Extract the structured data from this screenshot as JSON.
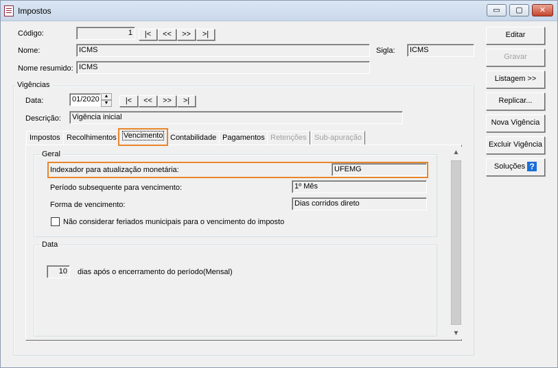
{
  "window": {
    "title": "Impostos",
    "controls": {
      "minimize": "▭",
      "maximize": "▢",
      "close": "✕"
    }
  },
  "header": {
    "codigo_label": "Código:",
    "codigo_value": "1",
    "nome_label": "Nome:",
    "nome_value": "ICMS",
    "sigla_label": "Sigla:",
    "sigla_value": "ICMS",
    "nome_resumido_label": "Nome resumido:",
    "nome_resumido_value": "ICMS"
  },
  "nav": {
    "first": "|<",
    "prev": "<<",
    "next": ">>",
    "last": ">|"
  },
  "vigencias": {
    "legend": "Vigências",
    "data_label": "Data:",
    "data_value": "01/2020",
    "descricao_label": "Descrição:",
    "descricao_value": "Vigência inicial"
  },
  "tabs": [
    {
      "label": "Impostos",
      "state": "normal"
    },
    {
      "label": "Recolhimentos",
      "state": "normal"
    },
    {
      "label": "Vencimento",
      "state": "active"
    },
    {
      "label": "Contabilidade",
      "state": "normal"
    },
    {
      "label": "Pagamentos",
      "state": "normal"
    },
    {
      "label": "Retenções",
      "state": "disabled"
    },
    {
      "label": "Sub-apuração",
      "state": "disabled"
    }
  ],
  "geral": {
    "legend": "Geral",
    "indexador_label": "Indexador para atualização monetária:",
    "indexador_value": "UFEMG",
    "periodo_label": "Período subsequente para vencimento:",
    "periodo_value": "1º Mês",
    "forma_label": "Forma de vencimento:",
    "forma_value": "Dias corridos direto",
    "feriados_label": "Não considerar feriados municipais para o vencimento do imposto",
    "feriados_checked": false
  },
  "data_group": {
    "legend": "Data",
    "dias_value": "10",
    "dias_label": "dias após o encerramento do período(Mensal)"
  },
  "buttons": {
    "editar": "Editar",
    "gravar": "Gravar",
    "listagem": "Listagem >>",
    "replicar": "Replicar...",
    "nova_vigencia": "Nova Vigência",
    "excluir_vigencia": "Excluir Vigência",
    "solucoes": "Soluções"
  },
  "colors": {
    "highlight": "#e8862a",
    "help_icon": "#1a6fd6"
  }
}
